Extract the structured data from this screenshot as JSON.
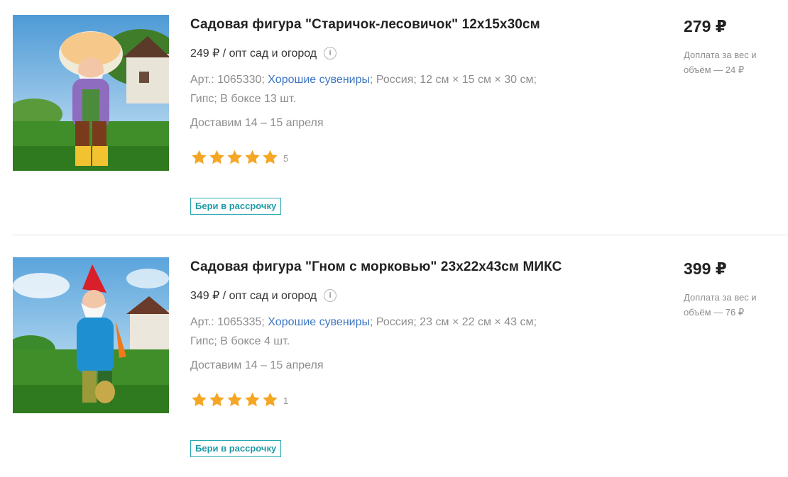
{
  "products": [
    {
      "title": "Садовая фигура \"Старичок-лесовичок\" 12х15х30см",
      "wholesale_price": "249 ₽ / опт сад и огород",
      "article": "Арт.: 1065330; ",
      "brand": "Хорошие сувениры",
      "specs_line1": "; Россия; 12 см × 15 см × 30 см;",
      "specs_line2": "Гипс; В боксе 13 шт.",
      "delivery": "Доставим 14 – 15 апреля",
      "rating": 5,
      "reviews": "5",
      "installment_label": "Бери в рассрочку",
      "price": "279 ₽",
      "surcharge": "Доплата за вес и объём — 24 ₽",
      "image_icon": "mushroom-gnome-figurine"
    },
    {
      "title": "Садовая фигура \"Гном с морковью\" 23х22х43см МИКС",
      "wholesale_price": "349 ₽ / опт сад и огород",
      "article": "Арт.: 1065335; ",
      "brand": "Хорошие сувениры",
      "specs_line1": "; Россия; 23 см × 22 см × 43 см;",
      "specs_line2": "Гипс; В боксе 4 шт.",
      "delivery": "Доставим 14 – 15 апреля",
      "rating": 5,
      "reviews": "1",
      "installment_label": "Бери в рассрочку",
      "price": "399 ₽",
      "surcharge": "Доплата за вес и объём — 76 ₽",
      "image_icon": "carrot-gnome-figurine"
    }
  ],
  "colors": {
    "accent_link": "#3d76c2",
    "star": "#f5a623",
    "installment_border": "#29a8b3",
    "muted_text": "#8d8d8d"
  },
  "info_icon": "info-icon"
}
